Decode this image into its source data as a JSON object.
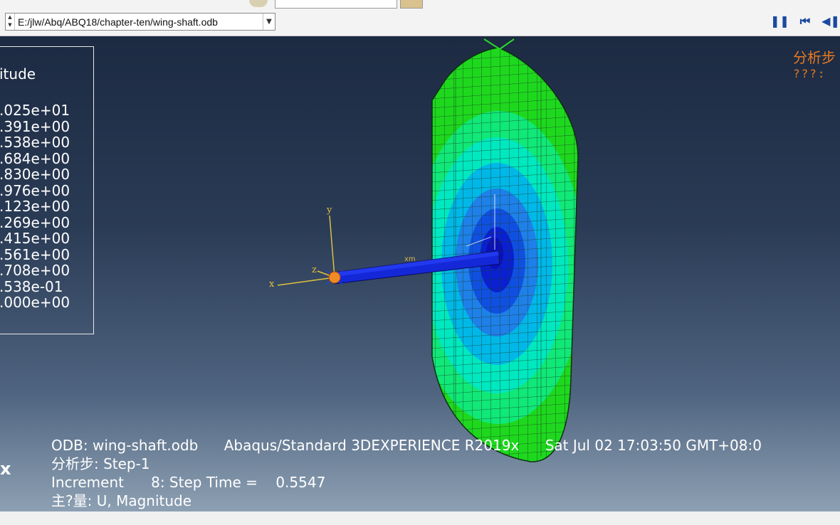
{
  "toolbar": {
    "odb_path": "E:/jlw/Abq/ABQ18/chapter-ten/wing-shaft.odb",
    "controls": [
      "pause-icon",
      "rewind-icon",
      "step-back-icon"
    ]
  },
  "legend": {
    "title": "itude",
    "values": [
      ".025e+01",
      ".391e+00",
      ".538e+00",
      ".684e+00",
      ".830e+00",
      ".976e+00",
      ".123e+00",
      ".269e+00",
      ".415e+00",
      ".561e+00",
      ".708e+00",
      ".538e-01",
      ".000e+00"
    ]
  },
  "step_info": {
    "line1": "分析步",
    "line2": "???:"
  },
  "triad": {
    "x": "x",
    "y": "y",
    "z": "z"
  },
  "bottom": {
    "odb": "ODB: wing-shaft.odb",
    "solver": "Abaqus/Standard 3DEXPERIENCE R2019x",
    "date": "Sat Jul 02 17:03:50 GMT+08:0",
    "step": "分析步: Step-1",
    "increment": "Increment      8: Step Time =    0.5547",
    "variable": "主?量: U, Magnitude"
  },
  "side_label": "x",
  "colors": {
    "viewport_top": "#1c2a42",
    "viewport_bottom": "#8da0b3",
    "contour": [
      "#00e000",
      "#00e8b8",
      "#00a8e8",
      "#0060e8",
      "#0010d0"
    ],
    "step_info": "#e87a1e"
  }
}
